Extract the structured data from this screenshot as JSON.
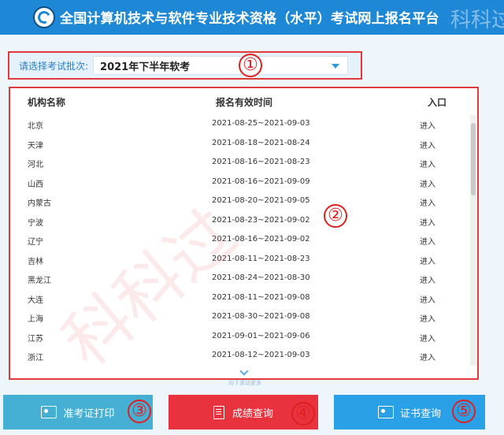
{
  "header": {
    "title": "全国计算机技术与软件专业技术资格（水平）考试网上报名平台",
    "watermark": "科科过"
  },
  "batch": {
    "label": "请选择考试批次:",
    "selected": "2021年下半年软考"
  },
  "table": {
    "columns": [
      "机构名称",
      "报名有效时间",
      "入口"
    ],
    "rows": [
      {
        "name": "北京",
        "period": "2021-08-25~2021-09-03",
        "entry": "进入"
      },
      {
        "name": "天津",
        "period": "2021-08-18~2021-08-24",
        "entry": "进入"
      },
      {
        "name": "河北",
        "period": "2021-08-16~2021-08-23",
        "entry": "进入"
      },
      {
        "name": "山西",
        "period": "2021-08-16~2021-09-09",
        "entry": "进入"
      },
      {
        "name": "内蒙古",
        "period": "2021-08-20~2021-09-05",
        "entry": "进入"
      },
      {
        "name": "宁波",
        "period": "2021-08-23~2021-09-02",
        "entry": "进入"
      },
      {
        "name": "辽宁",
        "period": "2021-08-16~2021-09-02",
        "entry": "进入"
      },
      {
        "name": "吉林",
        "period": "2021-08-11~2021-08-23",
        "entry": "进入"
      },
      {
        "name": "黑龙江",
        "period": "2021-08-24~2021-08-30",
        "entry": "进入"
      },
      {
        "name": "大连",
        "period": "2021-08-11~2021-09-08",
        "entry": "进入"
      },
      {
        "name": "上海",
        "period": "2021-08-30~2021-09-08",
        "entry": "进入"
      },
      {
        "name": "江苏",
        "period": "2021-09-01~2021-09-06",
        "entry": "进入"
      },
      {
        "name": "浙江",
        "period": "2021-08-12~2021-09-03",
        "entry": "进入"
      }
    ],
    "more_hint": "向下滚动更多"
  },
  "watermark_big": "科科过",
  "annotations": [
    "①",
    "②",
    "③",
    "④",
    "⑤"
  ],
  "buttons": {
    "admit": "准考证打印",
    "score": "成绩查询",
    "cert": "证书查询"
  },
  "icons": {
    "logo": "ruankao-logo",
    "admit": "id-card-icon",
    "score": "document-search-icon",
    "cert": "certificate-search-icon",
    "dropdown": "caret-down-icon",
    "more": "chevron-down-icon"
  },
  "colors": {
    "header": "#1e88d6",
    "annotation": "#e02020",
    "btn_admit": "#45b0d4",
    "btn_score": "#e8323e",
    "btn_cert": "#2aa0e6"
  }
}
